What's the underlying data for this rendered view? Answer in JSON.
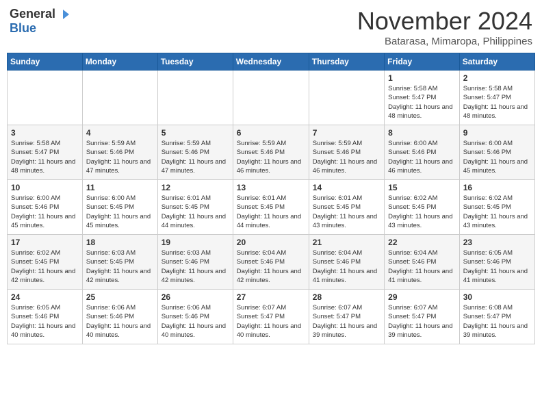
{
  "logo": {
    "general": "General",
    "blue": "Blue"
  },
  "title": "November 2024",
  "location": "Batarasa, Mimaropa, Philippines",
  "days_of_week": [
    "Sunday",
    "Monday",
    "Tuesday",
    "Wednesday",
    "Thursday",
    "Friday",
    "Saturday"
  ],
  "weeks": [
    [
      {
        "day": "",
        "info": ""
      },
      {
        "day": "",
        "info": ""
      },
      {
        "day": "",
        "info": ""
      },
      {
        "day": "",
        "info": ""
      },
      {
        "day": "",
        "info": ""
      },
      {
        "day": "1",
        "info": "Sunrise: 5:58 AM\nSunset: 5:47 PM\nDaylight: 11 hours and 48 minutes."
      },
      {
        "day": "2",
        "info": "Sunrise: 5:58 AM\nSunset: 5:47 PM\nDaylight: 11 hours and 48 minutes."
      }
    ],
    [
      {
        "day": "3",
        "info": "Sunrise: 5:58 AM\nSunset: 5:47 PM\nDaylight: 11 hours and 48 minutes."
      },
      {
        "day": "4",
        "info": "Sunrise: 5:59 AM\nSunset: 5:46 PM\nDaylight: 11 hours and 47 minutes."
      },
      {
        "day": "5",
        "info": "Sunrise: 5:59 AM\nSunset: 5:46 PM\nDaylight: 11 hours and 47 minutes."
      },
      {
        "day": "6",
        "info": "Sunrise: 5:59 AM\nSunset: 5:46 PM\nDaylight: 11 hours and 46 minutes."
      },
      {
        "day": "7",
        "info": "Sunrise: 5:59 AM\nSunset: 5:46 PM\nDaylight: 11 hours and 46 minutes."
      },
      {
        "day": "8",
        "info": "Sunrise: 6:00 AM\nSunset: 5:46 PM\nDaylight: 11 hours and 46 minutes."
      },
      {
        "day": "9",
        "info": "Sunrise: 6:00 AM\nSunset: 5:46 PM\nDaylight: 11 hours and 45 minutes."
      }
    ],
    [
      {
        "day": "10",
        "info": "Sunrise: 6:00 AM\nSunset: 5:46 PM\nDaylight: 11 hours and 45 minutes."
      },
      {
        "day": "11",
        "info": "Sunrise: 6:00 AM\nSunset: 5:45 PM\nDaylight: 11 hours and 45 minutes."
      },
      {
        "day": "12",
        "info": "Sunrise: 6:01 AM\nSunset: 5:45 PM\nDaylight: 11 hours and 44 minutes."
      },
      {
        "day": "13",
        "info": "Sunrise: 6:01 AM\nSunset: 5:45 PM\nDaylight: 11 hours and 44 minutes."
      },
      {
        "day": "14",
        "info": "Sunrise: 6:01 AM\nSunset: 5:45 PM\nDaylight: 11 hours and 43 minutes."
      },
      {
        "day": "15",
        "info": "Sunrise: 6:02 AM\nSunset: 5:45 PM\nDaylight: 11 hours and 43 minutes."
      },
      {
        "day": "16",
        "info": "Sunrise: 6:02 AM\nSunset: 5:45 PM\nDaylight: 11 hours and 43 minutes."
      }
    ],
    [
      {
        "day": "17",
        "info": "Sunrise: 6:02 AM\nSunset: 5:45 PM\nDaylight: 11 hours and 42 minutes."
      },
      {
        "day": "18",
        "info": "Sunrise: 6:03 AM\nSunset: 5:45 PM\nDaylight: 11 hours and 42 minutes."
      },
      {
        "day": "19",
        "info": "Sunrise: 6:03 AM\nSunset: 5:46 PM\nDaylight: 11 hours and 42 minutes."
      },
      {
        "day": "20",
        "info": "Sunrise: 6:04 AM\nSunset: 5:46 PM\nDaylight: 11 hours and 42 minutes."
      },
      {
        "day": "21",
        "info": "Sunrise: 6:04 AM\nSunset: 5:46 PM\nDaylight: 11 hours and 41 minutes."
      },
      {
        "day": "22",
        "info": "Sunrise: 6:04 AM\nSunset: 5:46 PM\nDaylight: 11 hours and 41 minutes."
      },
      {
        "day": "23",
        "info": "Sunrise: 6:05 AM\nSunset: 5:46 PM\nDaylight: 11 hours and 41 minutes."
      }
    ],
    [
      {
        "day": "24",
        "info": "Sunrise: 6:05 AM\nSunset: 5:46 PM\nDaylight: 11 hours and 40 minutes."
      },
      {
        "day": "25",
        "info": "Sunrise: 6:06 AM\nSunset: 5:46 PM\nDaylight: 11 hours and 40 minutes."
      },
      {
        "day": "26",
        "info": "Sunrise: 6:06 AM\nSunset: 5:46 PM\nDaylight: 11 hours and 40 minutes."
      },
      {
        "day": "27",
        "info": "Sunrise: 6:07 AM\nSunset: 5:47 PM\nDaylight: 11 hours and 40 minutes."
      },
      {
        "day": "28",
        "info": "Sunrise: 6:07 AM\nSunset: 5:47 PM\nDaylight: 11 hours and 39 minutes."
      },
      {
        "day": "29",
        "info": "Sunrise: 6:07 AM\nSunset: 5:47 PM\nDaylight: 11 hours and 39 minutes."
      },
      {
        "day": "30",
        "info": "Sunrise: 6:08 AM\nSunset: 5:47 PM\nDaylight: 11 hours and 39 minutes."
      }
    ]
  ]
}
